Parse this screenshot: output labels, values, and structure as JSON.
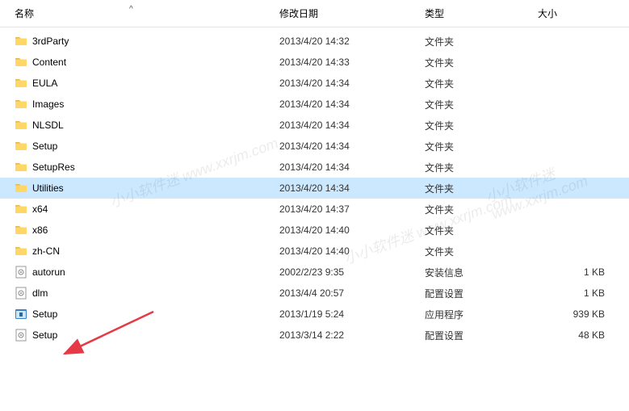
{
  "columns": {
    "name": "名称",
    "date": "修改日期",
    "type": "类型",
    "size": "大小"
  },
  "watermark_text": "小小软件迷 www.xxrjm.com",
  "files": [
    {
      "name": "3rdParty",
      "date": "2013/4/20 14:32",
      "type": "文件夹",
      "size": "",
      "icon": "folder"
    },
    {
      "name": "Content",
      "date": "2013/4/20 14:33",
      "type": "文件夹",
      "size": "",
      "icon": "folder"
    },
    {
      "name": "EULA",
      "date": "2013/4/20 14:34",
      "type": "文件夹",
      "size": "",
      "icon": "folder"
    },
    {
      "name": "Images",
      "date": "2013/4/20 14:34",
      "type": "文件夹",
      "size": "",
      "icon": "folder"
    },
    {
      "name": "NLSDL",
      "date": "2013/4/20 14:34",
      "type": "文件夹",
      "size": "",
      "icon": "folder"
    },
    {
      "name": "Setup",
      "date": "2013/4/20 14:34",
      "type": "文件夹",
      "size": "",
      "icon": "folder"
    },
    {
      "name": "SetupRes",
      "date": "2013/4/20 14:34",
      "type": "文件夹",
      "size": "",
      "icon": "folder"
    },
    {
      "name": "Utilities",
      "date": "2013/4/20 14:34",
      "type": "文件夹",
      "size": "",
      "icon": "folder",
      "highlighted": true
    },
    {
      "name": "x64",
      "date": "2013/4/20 14:37",
      "type": "文件夹",
      "size": "",
      "icon": "folder"
    },
    {
      "name": "x86",
      "date": "2013/4/20 14:40",
      "type": "文件夹",
      "size": "",
      "icon": "folder"
    },
    {
      "name": "zh-CN",
      "date": "2013/4/20 14:40",
      "type": "文件夹",
      "size": "",
      "icon": "folder"
    },
    {
      "name": "autorun",
      "date": "2002/2/23 9:35",
      "type": "安装信息",
      "size": "1 KB",
      "icon": "config"
    },
    {
      "name": "dlm",
      "date": "2013/4/4 20:57",
      "type": "配置设置",
      "size": "1 KB",
      "icon": "config"
    },
    {
      "name": "Setup",
      "date": "2013/1/19 5:24",
      "type": "应用程序",
      "size": "939 KB",
      "icon": "exe"
    },
    {
      "name": "Setup",
      "date": "2013/3/14 2:22",
      "type": "配置设置",
      "size": "48 KB",
      "icon": "config"
    }
  ]
}
